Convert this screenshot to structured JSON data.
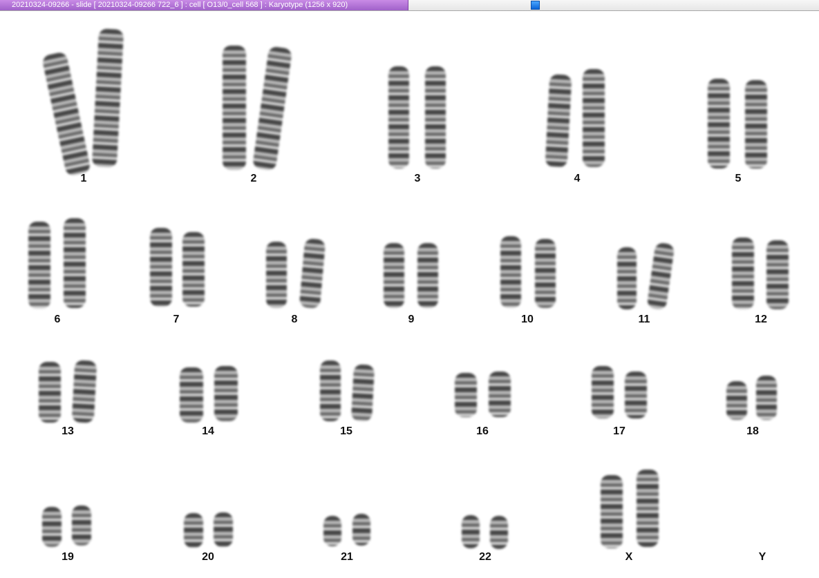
{
  "window": {
    "title": "20210324-09266 - slide [ 20210324-09266 722_6 ] : cell [ O13/0_cell 568 ] : Karyotype  (1256 x 920)"
  },
  "karyotype": {
    "pairs": [
      "1",
      "2",
      "3",
      "4",
      "5",
      "6",
      "7",
      "8",
      "9",
      "10",
      "11",
      "12",
      "13",
      "14",
      "15",
      "16",
      "17",
      "18",
      "19",
      "20",
      "21",
      "22",
      "X",
      "Y"
    ]
  },
  "colors": {
    "title_bar": "#b576d9",
    "scroll_thumb": "#1a7ae6"
  }
}
